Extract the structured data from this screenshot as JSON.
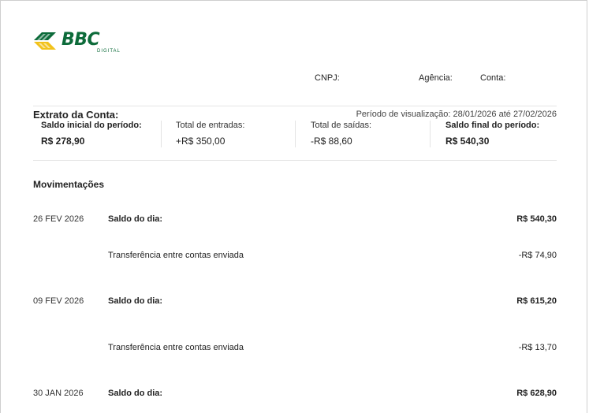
{
  "logo": {
    "brand": "BBC",
    "sub": "DIGITAL"
  },
  "account": {
    "cnpj_label": "CNPJ:",
    "agencia_label": "Agência:",
    "conta_label": "Conta:"
  },
  "statement": {
    "title": "Extrato da Conta:",
    "period": "Período de visualização: 28/01/2026 até 27/02/2026"
  },
  "summary": [
    {
      "label": "Saldo inicial do período:",
      "value": "R$ 278,90"
    },
    {
      "label": "Total de entradas:",
      "value": "+R$ 350,00"
    },
    {
      "label": "Total de saídas:",
      "value": "-R$ 88,60"
    },
    {
      "label": "Saldo final do período:",
      "value": "R$ 540,30"
    }
  ],
  "movements": {
    "title": "Movimentações",
    "days": [
      {
        "date": "26 FEV 2026",
        "balance_label": "Saldo do dia:",
        "balance": "R$ 540,30",
        "items": [
          {
            "desc": "Transferência entre contas enviada",
            "amount": "-R$ 74,90"
          }
        ]
      },
      {
        "date": "09 FEV 2026",
        "balance_label": "Saldo do dia:",
        "balance": "R$ 615,20",
        "items": [
          {
            "desc": "Transferência entre contas enviada",
            "amount": "-R$ 13,70"
          }
        ]
      },
      {
        "date": "30 JAN 2026",
        "balance_label": "Saldo do dia:",
        "balance": "R$ 628,90",
        "items": []
      }
    ]
  },
  "colors": {
    "brand_green": "#0d6b3a",
    "brand_yellow": "#f2c21b"
  }
}
